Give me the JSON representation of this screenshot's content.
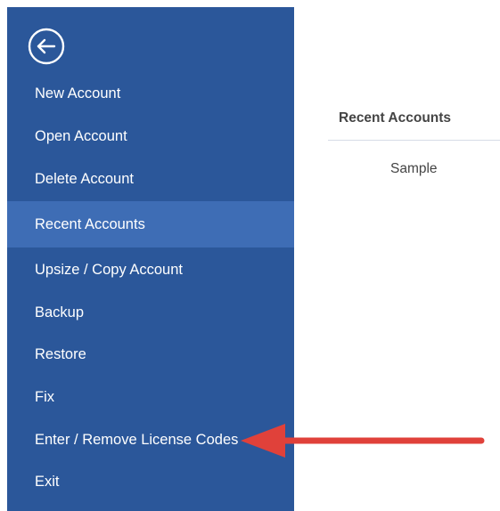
{
  "sidebar": {
    "back_icon": "arrow-left-circle-icon",
    "background_color": "#2b579a",
    "active_color": "#3e6db5",
    "items": [
      {
        "label": "New Account"
      },
      {
        "label": "Open Account"
      },
      {
        "label": "Delete Account"
      },
      {
        "label": "Recent Accounts"
      },
      {
        "label": "Upsize / Copy Account"
      },
      {
        "label": "Backup"
      },
      {
        "label": "Restore"
      },
      {
        "label": "Fix"
      },
      {
        "label": "Enter / Remove License Codes"
      },
      {
        "label": "Exit"
      }
    ],
    "active_item": "Recent Accounts"
  },
  "recent_panel": {
    "header": "Recent Accounts",
    "items": [
      {
        "label": "Sample"
      }
    ]
  },
  "annotation": {
    "icon": "red-arrow-pointing-left-icon",
    "color": "#e0413a"
  }
}
